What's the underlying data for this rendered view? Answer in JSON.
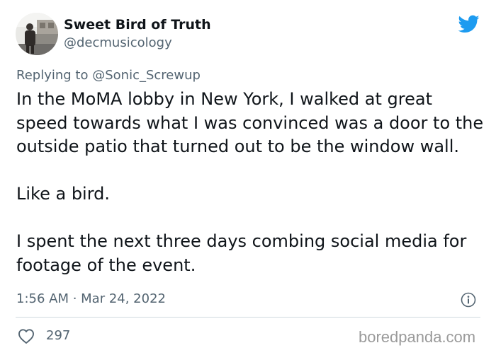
{
  "tweet": {
    "author": {
      "display_name": "Sweet Bird of Truth",
      "handle": "@decmusicology",
      "avatar_icon": "avatar-photo"
    },
    "reply": {
      "prefix": "Replying to",
      "mention": "@Sonic_Screwup"
    },
    "paragraphs": [
      "In the MoMA lobby in New York, I walked at great speed towards what I was convinced was a door to the outside patio that turned out to be the window wall.",
      "Like a bird.",
      "I spent the next three days combing social media for footage of the event."
    ],
    "timestamp": "1:56 AM · Mar 24, 2022",
    "likes": "297",
    "brand_icon": "twitter-bird-icon",
    "brand_color": "#1d9bf0"
  },
  "watermark": "boredpanda.com"
}
